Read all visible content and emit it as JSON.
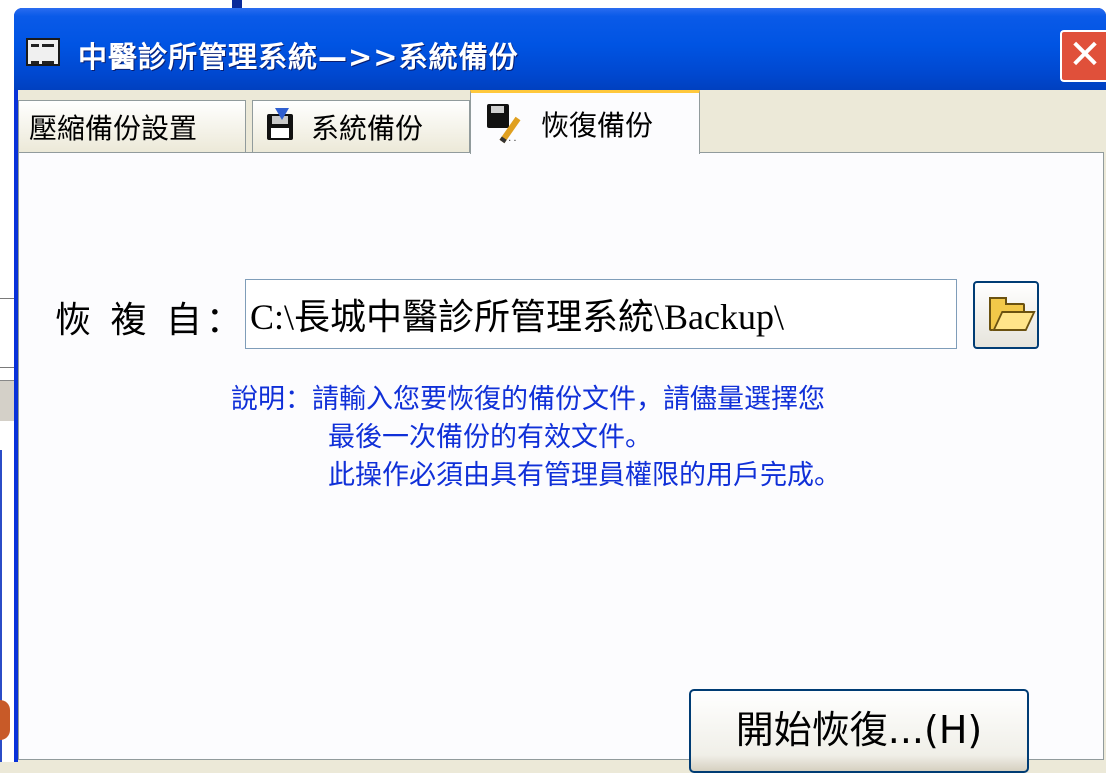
{
  "window": {
    "title": "中醫診所管理系統—>>系統備份",
    "close_glyph": "✕"
  },
  "tabs": [
    {
      "label": "壓縮備份設置",
      "icon": "none",
      "active": false
    },
    {
      "label": "系統備份",
      "icon": "floppy-download-icon",
      "active": false
    },
    {
      "label": "恢復備份",
      "icon": "floppy-edit-icon",
      "active": true
    }
  ],
  "restore": {
    "field_label": "恢 複 自：",
    "path_value": "C:\\長城中醫診所管理系統\\Backup\\",
    "browse_icon": "open-folder-icon",
    "note_line1": "說明：請輸入您要恢復的備份文件，請儘量選擇您",
    "note_line2": "最後一次備份的有效文件。",
    "note_line3": "此操作必須由具有管理員權限的用戶完成。",
    "start_button": "開始恢復...(H)"
  },
  "colors": {
    "titlebar": "#0054e3",
    "note_text": "#1030d8",
    "active_tab_highlight": "#ffc83c",
    "close_button": "#e0503a"
  }
}
